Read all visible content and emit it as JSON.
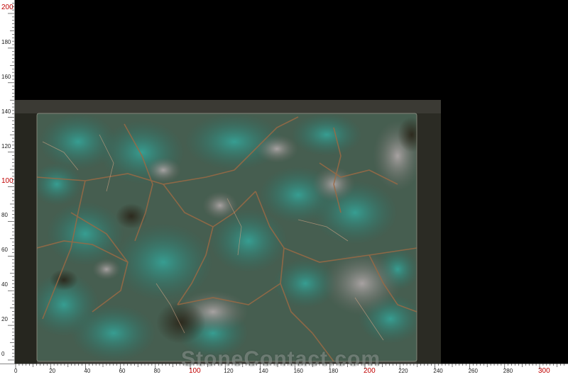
{
  "colors": {
    "background": "#000000",
    "ruler_bg": "#ffffff",
    "tick_major": "#c00000",
    "tick_minor": "#222222",
    "stone_base": "#3f5a4c",
    "stone_teal": "#2f8a80",
    "vein": "#8a5a3a",
    "frame": "#3a3a34"
  },
  "ruler_left": {
    "labels": [
      "0",
      "20",
      "40",
      "60",
      "80",
      "100",
      "120",
      "140",
      "160",
      "180",
      "200"
    ],
    "major_labels": [
      "100",
      "200"
    ]
  },
  "ruler_bottom": {
    "labels": [
      "0",
      "20",
      "40",
      "60",
      "80",
      "100",
      "120",
      "140",
      "160",
      "180",
      "200",
      "220",
      "240",
      "260",
      "280",
      "300"
    ],
    "major_labels": [
      "100",
      "200",
      "300"
    ]
  },
  "watermark": "StoneContact.com",
  "subject": {
    "icon": "amazonite-slab-photo"
  }
}
